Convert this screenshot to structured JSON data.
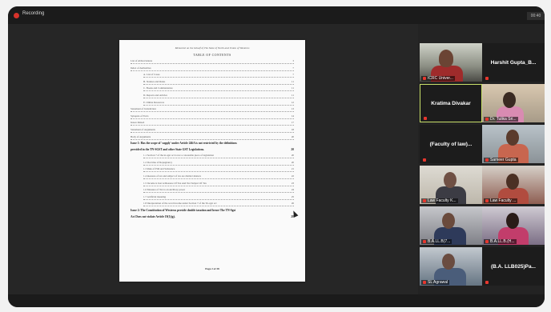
{
  "topbar": {
    "recording_label": "Recording",
    "clock": "00:40"
  },
  "document": {
    "title_line": "Memorial on the behalf of The State of North and Union of Westeros",
    "heading": "TABLE OF CONTENTS",
    "toc": [
      {
        "text": "List of Abbreviations",
        "page": "3"
      },
      {
        "text": "Index of Authorities",
        "page": "7"
      },
      {
        "text": "A.   List of Cases",
        "page": "7"
      },
      {
        "text": "B.   Statutes and Rules",
        "page": "11"
      },
      {
        "text": "C.   Books and Commentaries",
        "page": "11"
      },
      {
        "text": "D.   Reports and Articles",
        "page": "11"
      },
      {
        "text": "E.   Online Resources",
        "page": "12"
      },
      {
        "text": "Statement of Jurisdiction",
        "page": "13"
      },
      {
        "text": "Synopsis of Facts",
        "page": "14"
      },
      {
        "text": "Issues Raised",
        "page": "17"
      },
      {
        "text": "Statement of Arguments",
        "page": "18"
      },
      {
        "text": "Body of Arguments",
        "page": "20"
      },
      {
        "text": "Issue 1: Has the scope of 'supply' under Article 246A is not restricted by the definitions",
        "page": "",
        "bold": true
      },
      {
        "text": "provided in the TN-SGST and other State GST Legislations.",
        "page": "20",
        "bold": true
      },
      {
        "text": "1.1     Section 7 of the tn-sgst act is not a colourable piece of legislation",
        "page": "20"
      },
      {
        "text": "1.2     Doctrine of Repugnancy",
        "page": "20"
      },
      {
        "text": "1.3     Rule of Pith and Substance",
        "page": "21"
      },
      {
        "text": "1.4     measure of tax and subject of tax are distinct matters",
        "page": "22"
      },
      {
        "text": "1.5     Income is Just A Measure Of Tax And Not Subject Of Tax",
        "page": "23"
      },
      {
        "text": "1.6     Measure of Tax is an ancillary power",
        "page": "24"
      },
      {
        "text": "1.7     Artificial meaning",
        "page": "25"
      },
      {
        "text": "1.8     Interpretation of the word income under Section 7 of the Tn-sgst act",
        "page": "26"
      },
      {
        "text": "Issue 2: The Constitution of Westeros provide double taxation and hence The TN-Sgst",
        "page": "",
        "bold": true
      },
      {
        "text": "Act Does not violate Article 19(1)(g).",
        "page": "28",
        "bold": true
      }
    ],
    "footer": "Page 2 of 38"
  },
  "participants": [
    {
      "label": "ICRC Univer...",
      "has_video": true
    },
    {
      "label": "Harshit  Gupta_B...",
      "has_video": false
    },
    {
      "label": "Kratima Divakar",
      "has_video": false,
      "speaking": true
    },
    {
      "label": "Dr. Tulika Sri...",
      "has_video": true
    },
    {
      "label": "(Faculty of law)...",
      "has_video": false
    },
    {
      "label": "Sameer Gupta",
      "has_video": true
    },
    {
      "label": "Law Faculty K...",
      "has_video": true
    },
    {
      "label": "Law Faculty ...",
      "has_video": true
    },
    {
      "label": "B.A.LL.B(7...",
      "has_video": true
    },
    {
      "label": "B.A.LL.B.(H...",
      "has_video": true
    },
    {
      "label": "SL Agrawal",
      "has_video": true
    },
    {
      "label": "(B.A. LLB025)Pa...",
      "has_video": false
    }
  ],
  "colors": {
    "speaking_border": "#c8df69",
    "mic_muted": "#e6372e",
    "recording": "#d7332b"
  }
}
